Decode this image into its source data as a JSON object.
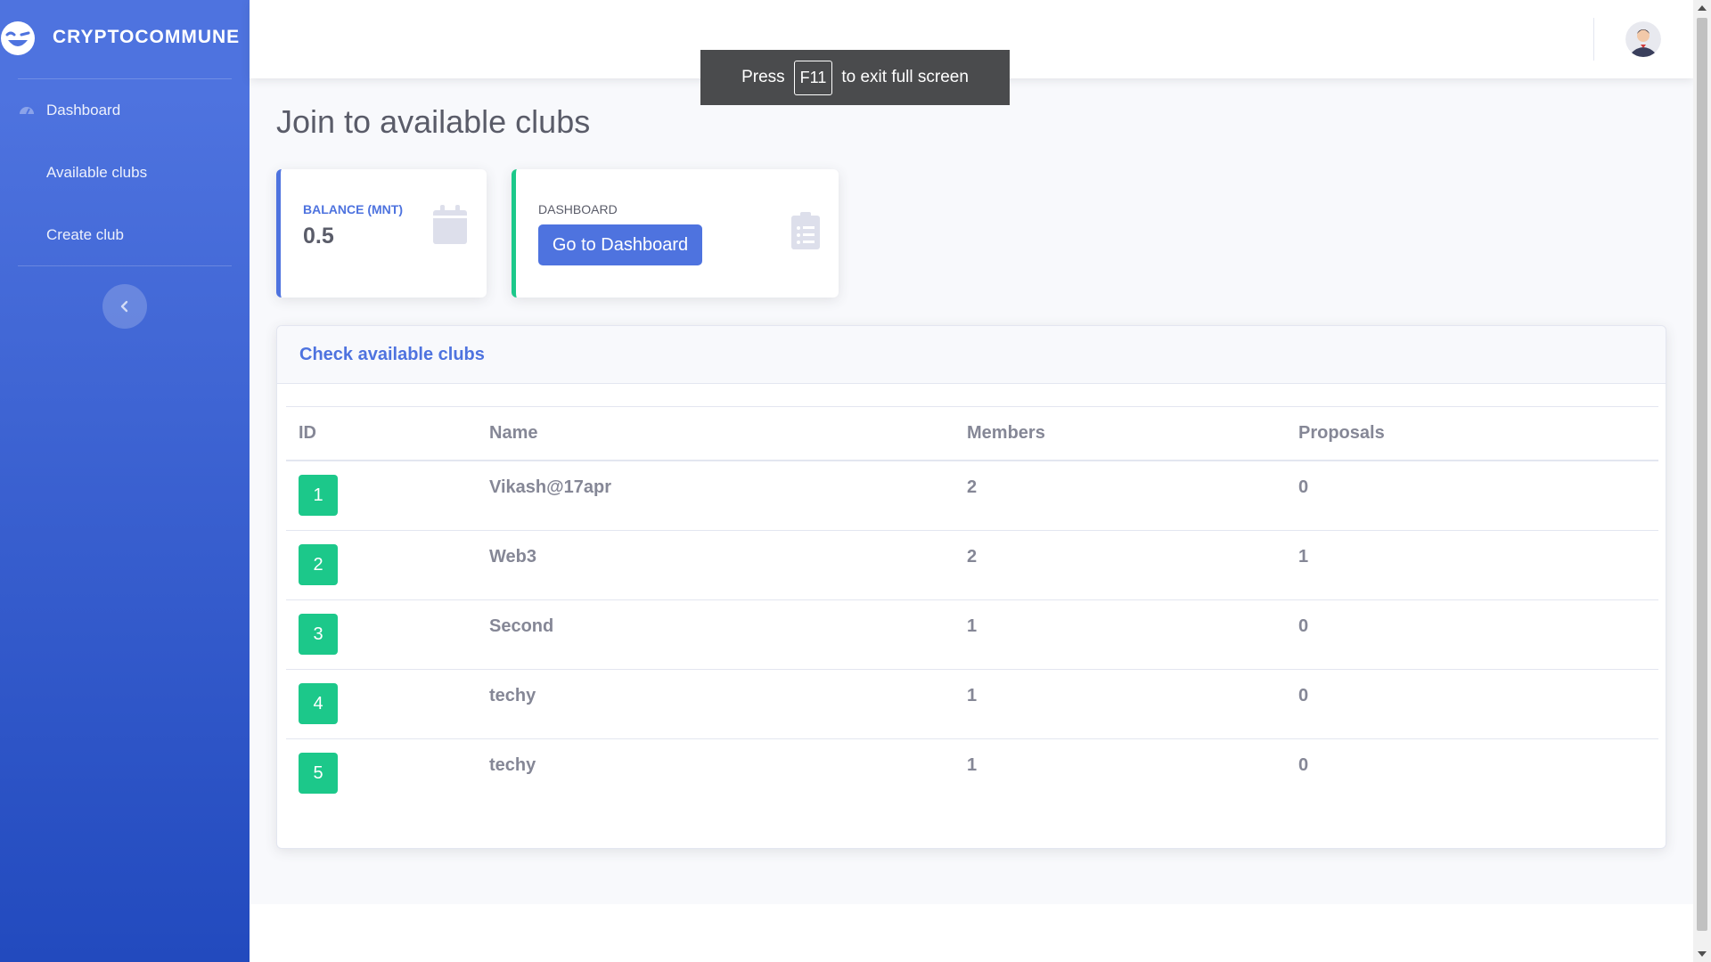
{
  "brand": {
    "name": "CRYPTOCOMMUNE",
    "icon": "laughing-wink-icon"
  },
  "sidebar": {
    "items": [
      {
        "label": "Dashboard",
        "icon": "tachometer-icon"
      },
      {
        "label": "Available clubs"
      },
      {
        "label": "Create club"
      }
    ],
    "toggle_icon": "chevron-left-icon"
  },
  "topbar": {
    "avatar_icon": "user-avatar-icon"
  },
  "fullscreen_toast": {
    "prefix": "Press",
    "key": "F11",
    "suffix": "to exit full screen"
  },
  "page": {
    "title": "Join to available clubs"
  },
  "cards": {
    "balance": {
      "label": "BALANCE (MNT)",
      "value": "0.5",
      "icon": "calendar-icon"
    },
    "dashboard": {
      "label": "DASHBOARD",
      "button": "Go to Dashboard",
      "icon": "clipboard-list-icon"
    }
  },
  "clubs_card": {
    "title": "Check available clubs",
    "columns": [
      "ID",
      "Name",
      "Members",
      "Proposals"
    ],
    "rows": [
      {
        "id": "1",
        "name": "Vikash@17apr",
        "members": "2",
        "proposals": "0"
      },
      {
        "id": "2",
        "name": "Web3",
        "members": "2",
        "proposals": "1"
      },
      {
        "id": "3",
        "name": "Second",
        "members": "1",
        "proposals": "0"
      },
      {
        "id": "4",
        "name": "techy",
        "members": "1",
        "proposals": "0"
      },
      {
        "id": "5",
        "name": "techy",
        "members": "1",
        "proposals": "0"
      }
    ]
  },
  "colors": {
    "primary": "#4e73df",
    "success": "#1cc88a",
    "text": "#858796",
    "heading": "#5a5c69"
  }
}
